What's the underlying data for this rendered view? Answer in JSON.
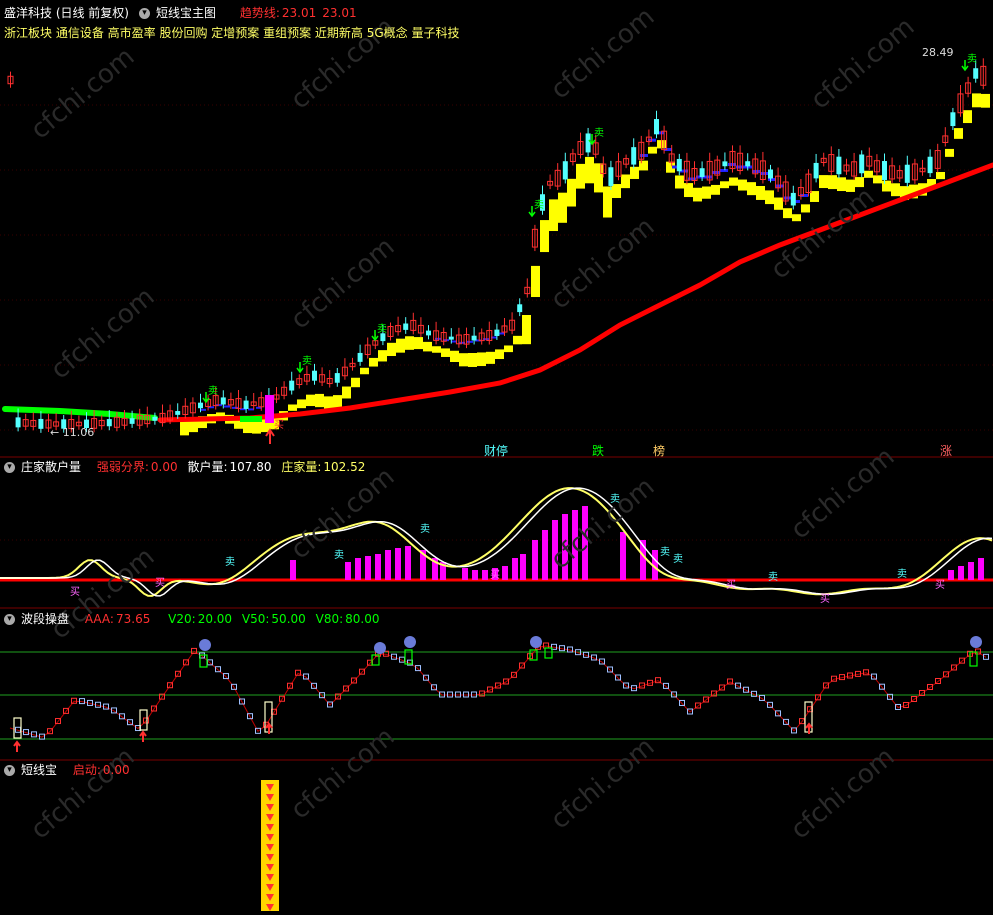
{
  "header": {
    "stock_title": "盛洋科技 (日线 前复权)",
    "indicator_name": "短线宝主图",
    "trend_label": "趋势线:",
    "trend_value": "23.01",
    "trend_value2": "23.01",
    "concepts": "浙江板块 通信设备 高市盈率 股份回购 定增预案 重组预案 近期新高  5G概念 量子科技"
  },
  "main_chart": {
    "high_price_label": "28.49",
    "low_price_label": "← 11.06",
    "buy_label": "买",
    "sell_label": "卖",
    "event_tags": [
      "财停",
      "跌",
      "榜",
      "涨"
    ],
    "colors": {
      "up": "#ff3030",
      "down": "#54ffff",
      "trend": "#ff0000",
      "ribbon": "#ffff00",
      "blue": "#2020ff",
      "green": "#00ff00",
      "magenta": "#ff00ff"
    }
  },
  "pane2": {
    "name": "庄家散户量",
    "field1_label": "强弱分界:",
    "field1_value": "0.00",
    "field2_label": "散户量:",
    "field2_value": "107.80",
    "field3_label": "庄家量:",
    "field3_value": "102.52",
    "marker_buy": "买",
    "marker_sell": "卖"
  },
  "pane3": {
    "name": "波段操盘",
    "aaa_label": "AAA:",
    "aaa_value": "73.65",
    "v20_label": "V20:",
    "v20_value": "20.00",
    "v50_label": "V50:",
    "v50_value": "50.00",
    "v80_label": "V80:",
    "v80_value": "80.00"
  },
  "pane4": {
    "name": "短线宝",
    "start_label": "启动:",
    "start_value": "0.00"
  },
  "watermark": "cfchi.com"
}
